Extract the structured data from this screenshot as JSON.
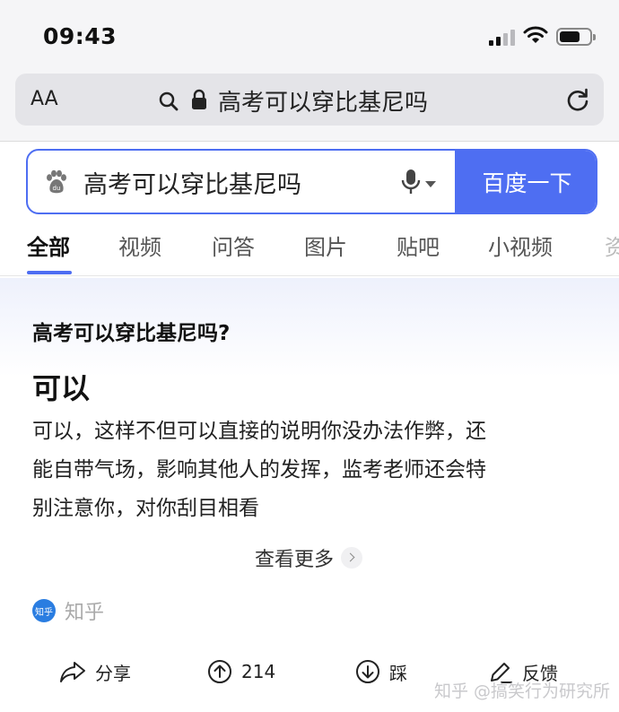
{
  "status_bar": {
    "time": "09:43"
  },
  "browser": {
    "text_size_label": "AA",
    "url_text": "高考可以穿比基尼吗"
  },
  "search": {
    "query": "高考可以穿比基尼吗",
    "button_label": "百度一下"
  },
  "tabs": [
    {
      "label": "全部",
      "active": true
    },
    {
      "label": "视频"
    },
    {
      "label": "问答"
    },
    {
      "label": "图片"
    },
    {
      "label": "贴吧"
    },
    {
      "label": "小视频"
    },
    {
      "label": "资"
    }
  ],
  "result": {
    "question": "高考可以穿比基尼吗?",
    "answer_head": "可以",
    "answer_lines": [
      "可以，这样不但可以直接的说明你没办法作弊，还",
      "能自带气场，影响其他人的发挥，监考老师还会特",
      "别注意你，对你刮目相看"
    ],
    "more_label": "查看更多",
    "source_logo_text": "知乎",
    "source_name": "知乎"
  },
  "actions": {
    "share": "分享",
    "upvote_count": "214",
    "downvote": "踩",
    "feedback": "反馈"
  },
  "watermark": "知乎 @搞笑行为研究所",
  "colors": {
    "accent": "#4e6ef2",
    "zhihu_blue": "#2a7de1"
  }
}
